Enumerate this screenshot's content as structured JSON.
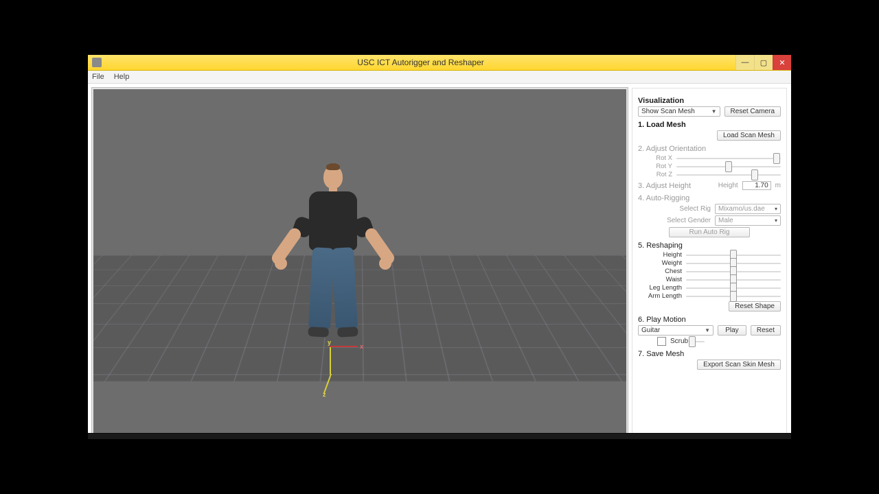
{
  "window": {
    "title": "USC ICT Autorigger and Reshaper"
  },
  "menu": {
    "file": "File",
    "help": "Help"
  },
  "axes": {
    "x": "x",
    "y": "y",
    "z": "z"
  },
  "panel": {
    "visualization": {
      "heading": "Visualization",
      "mode": "Show Scan Mesh",
      "reset_camera": "Reset Camera"
    },
    "load": {
      "heading": "1. Load Mesh",
      "button": "Load Scan Mesh"
    },
    "orient": {
      "heading": "2. Adjust Orientation",
      "rot_x": "Rot X",
      "rot_y": "Rot Y",
      "rot_z": "Rot Z"
    },
    "height": {
      "heading": "3. Adjust Height",
      "label": "Height",
      "value": "1.70",
      "unit": "m"
    },
    "rig": {
      "heading": "4. Auto-Rigging",
      "select_rig_label": "Select Rig",
      "select_rig_value": "Mixamo/us.dae",
      "select_gender_label": "Select Gender",
      "select_gender_value": "Male",
      "run": "Run Auto Rig"
    },
    "reshape": {
      "heading": "5. Reshaping",
      "params": [
        "Height",
        "Weight",
        "Chest",
        "Waist",
        "Leg Length",
        "Arm Length"
      ],
      "reset": "Reset Shape"
    },
    "motion": {
      "heading": "6. Play Motion",
      "clip": "Guitar",
      "play": "Play",
      "reset": "Reset",
      "scrub": "Scrub"
    },
    "save": {
      "heading": "7. Save Mesh",
      "export": "Export Scan Skin Mesh"
    }
  }
}
